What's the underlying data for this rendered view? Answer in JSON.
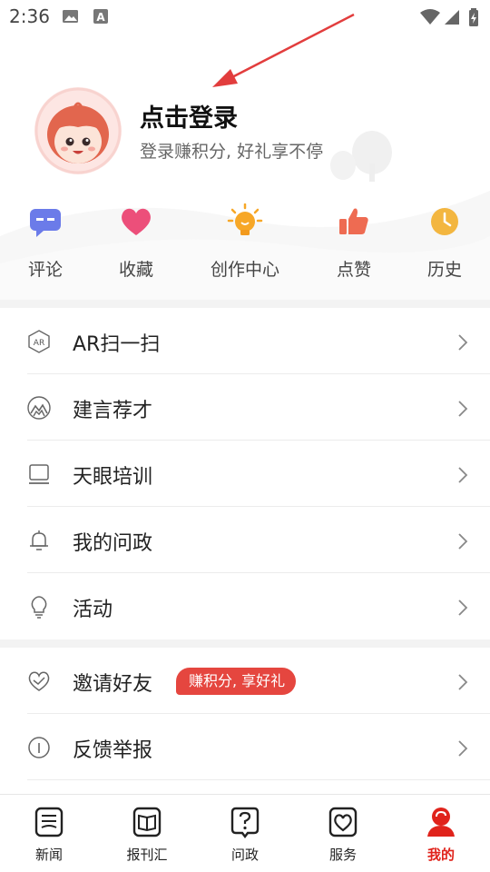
{
  "status_bar": {
    "time": "2:36",
    "icons": [
      "image-icon",
      "a-icon",
      "wifi-icon",
      "signal-icon",
      "battery-icon"
    ]
  },
  "profile": {
    "title": "点击登录",
    "subtitle": "登录赚积分, 好礼享不停",
    "avatar_icon": "girl-avatar-icon"
  },
  "quick_actions": [
    {
      "label": "评论",
      "icon": "comment-icon",
      "color": "#6b7be9"
    },
    {
      "label": "收藏",
      "icon": "heart-icon",
      "color": "#ec4f7a"
    },
    {
      "label": "创作中心",
      "icon": "lightbulb-icon",
      "color": "#f7a727"
    },
    {
      "label": "点赞",
      "icon": "thumbs-up-icon",
      "color": "#ee6b52"
    },
    {
      "label": "历史",
      "icon": "clock-icon",
      "color": "#f3b640"
    }
  ],
  "menu_group1": [
    {
      "label": "AR扫一扫",
      "icon": "ar-icon"
    },
    {
      "label": "建言荐才",
      "icon": "mountain-icon"
    },
    {
      "label": "天眼培训",
      "icon": "laptop-icon"
    },
    {
      "label": "我的问政",
      "icon": "bell-icon"
    },
    {
      "label": "活动",
      "icon": "bulb-outline-icon"
    }
  ],
  "menu_group2": [
    {
      "label": "邀请好友",
      "icon": "handshake-icon",
      "badge": "赚积分, 享好礼"
    },
    {
      "label": "反馈举报",
      "icon": "info-icon"
    }
  ],
  "bottom_nav": [
    {
      "label": "新闻",
      "icon": "news-icon",
      "active": false
    },
    {
      "label": "报刊汇",
      "icon": "book-icon",
      "active": false
    },
    {
      "label": "问政",
      "icon": "question-icon",
      "active": false
    },
    {
      "label": "服务",
      "icon": "service-heart-icon",
      "active": false
    },
    {
      "label": "我的",
      "icon": "user-icon",
      "active": true
    }
  ],
  "colors": {
    "accent": "#e0231b",
    "badge": "#e5463f",
    "arrow": "#e23d3d"
  }
}
